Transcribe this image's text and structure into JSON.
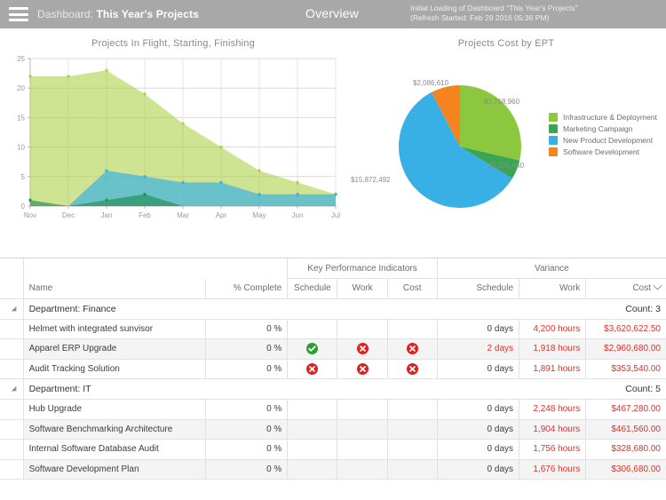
{
  "topbar": {
    "menu_icon": "hamburger-icon",
    "breadcrumb_prefix": "Dashboard: ",
    "breadcrumb_name": "This Year's Projects",
    "view_title": "Overview",
    "refresh_note": "Initial Loading of Dashboard \"This Year's Projects\" (Refresh Started: Feb 29 2016 05:36 PM)",
    "bar_color": "#a8a8a8"
  },
  "chart_data": [
    {
      "type": "area",
      "title": "Projects In Flight, Starting, Finishing",
      "xlabel": "",
      "ylabel": "",
      "categories": [
        "Nov",
        "Dec",
        "Jan",
        "Feb",
        "Mar",
        "Apr",
        "May",
        "Jun",
        "Jul"
      ],
      "ylim": [
        0,
        25
      ],
      "yticks": [
        0,
        5,
        10,
        15,
        20,
        25
      ],
      "grid": true,
      "legend_position": "bottom",
      "series": [
        {
          "name": "In Flight",
          "color": "#a6ce39",
          "values": [
            22,
            22,
            23,
            19,
            14,
            10,
            6,
            4,
            2
          ]
        },
        {
          "name": "Starting",
          "color": "#1f8a4c",
          "values": [
            1,
            0,
            1,
            2,
            0,
            0,
            0,
            0,
            0
          ]
        },
        {
          "name": "Finishing",
          "color": "#2badeb",
          "values": [
            0,
            0,
            6,
            5,
            4,
            4,
            2,
            2,
            2
          ]
        }
      ]
    },
    {
      "type": "pie",
      "title": "Projects Cost by EPT",
      "legend_position": "right",
      "labels": [
        "Infrastructure & Deployment",
        "Marketing Campaign",
        "New Product Development",
        "Software Development"
      ],
      "values": [
        7768960,
        1372440,
        15872492,
        2086610
      ],
      "value_labels": [
        "$7,768,960",
        "$1,372,440",
        "$15,872,492",
        "$2,086,610"
      ],
      "colors": [
        "#8dc63f",
        "#3aa655",
        "#39b0e5",
        "#f5841f"
      ]
    }
  ],
  "table": {
    "group_headers": [
      {
        "label": "",
        "span": 3
      },
      {
        "label": "Key Performance Indicators",
        "span": 3
      },
      {
        "label": "Variance",
        "span": 3
      }
    ],
    "columns": [
      {
        "key": "tri",
        "label": ""
      },
      {
        "key": "name",
        "label": "Name"
      },
      {
        "key": "pct",
        "label": "% Complete"
      },
      {
        "key": "kpi_schedule",
        "label": "Schedule"
      },
      {
        "key": "kpi_work",
        "label": "Work"
      },
      {
        "key": "kpi_cost",
        "label": "Cost"
      },
      {
        "key": "var_schedule",
        "label": "Schedule"
      },
      {
        "key": "var_work",
        "label": "Work"
      },
      {
        "key": "var_cost",
        "label": "Cost",
        "sort": "desc"
      }
    ],
    "groups": [
      {
        "label": "Department: Finance",
        "count_label": "Count: 3",
        "rows": [
          {
            "name": "Helmet with integrated sunvisor",
            "pct": "0 %",
            "kpi_schedule": "",
            "kpi_work": "",
            "kpi_cost": "",
            "var_schedule": "0 days",
            "var_work": "4,200 hours",
            "var_cost": "$3,620,622.50"
          },
          {
            "name": "Apparel ERP Upgrade",
            "pct": "0 %",
            "kpi_schedule": "ok",
            "kpi_work": "bad",
            "kpi_cost": "bad",
            "var_schedule": "2 days",
            "var_work": "1,918 hours",
            "var_cost": "$2,960,680.00"
          },
          {
            "name": "Audit Tracking Solution",
            "pct": "0 %",
            "kpi_schedule": "bad",
            "kpi_work": "bad",
            "kpi_cost": "bad",
            "var_schedule": "0 days",
            "var_work": "1,891 hours",
            "var_cost": "$353,540.00"
          }
        ]
      },
      {
        "label": "Department: IT",
        "count_label": "Count: 5",
        "rows": [
          {
            "name": "Hub Upgrade",
            "pct": "0 %",
            "kpi_schedule": "",
            "kpi_work": "",
            "kpi_cost": "",
            "var_schedule": "0 days",
            "var_work": "2,248 hours",
            "var_cost": "$467,280.00"
          },
          {
            "name": "Software Benchmarking Architecture",
            "pct": "0 %",
            "kpi_schedule": "",
            "kpi_work": "",
            "kpi_cost": "",
            "var_schedule": "0 days",
            "var_work": "1,904 hours",
            "var_cost": "$461,560.00"
          },
          {
            "name": "Internal Software Database Audit",
            "pct": "0 %",
            "kpi_schedule": "",
            "kpi_work": "",
            "kpi_cost": "",
            "var_schedule": "0 days",
            "var_work": "1,756 hours",
            "var_cost": "$328,680.00"
          },
          {
            "name": "Software Development Plan",
            "pct": "0 %",
            "kpi_schedule": "",
            "kpi_work": "",
            "kpi_cost": "",
            "var_schedule": "0 days",
            "var_work": "1,676 hours",
            "var_cost": "$306,680.00"
          }
        ]
      }
    ]
  }
}
